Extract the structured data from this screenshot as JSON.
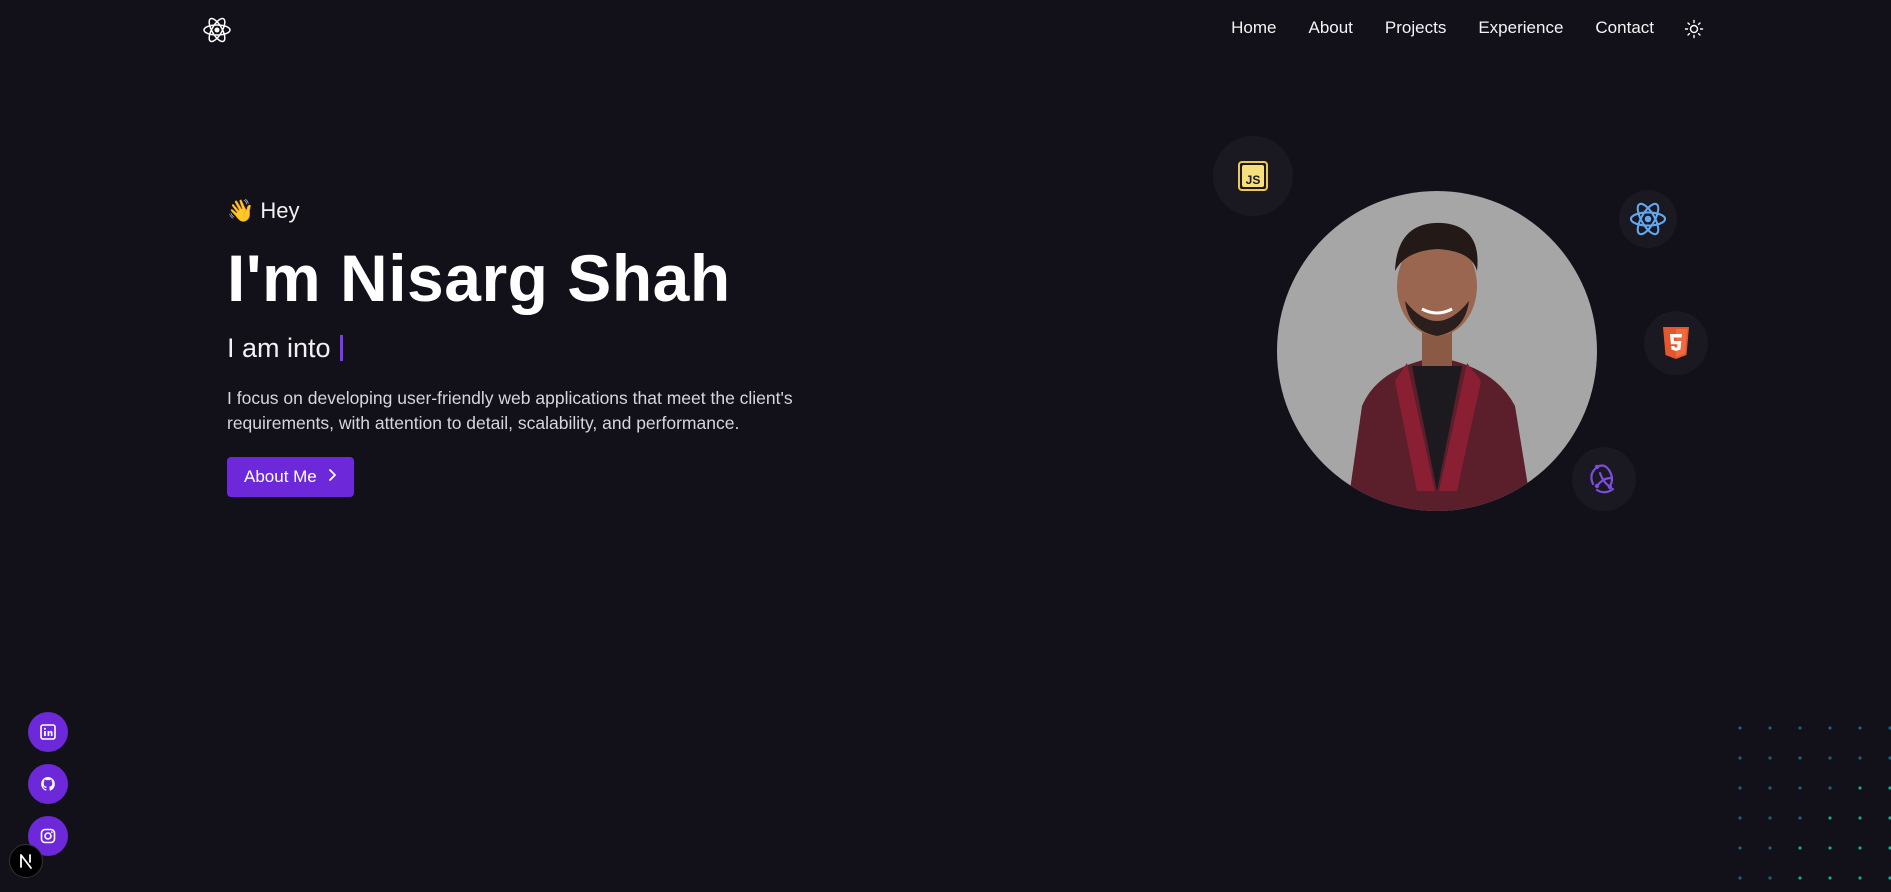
{
  "nav": {
    "links": [
      "Home",
      "About",
      "Projects",
      "Experience",
      "Contact"
    ],
    "logo_icon": "react-atom-icon",
    "theme_icon": "sun-icon"
  },
  "hero": {
    "greeting_emoji": "👋",
    "greeting": "Hey",
    "name": "I'm Nisarg Shah",
    "intro_prefix": "I am into",
    "description": "I focus on developing user-friendly web applications that meet the client's requirements, with attention to detail, scalability, and performance.",
    "cta_label": "About Me"
  },
  "tech_icons": [
    "javascript-icon",
    "react-icon",
    "html5-icon",
    "redux-icon"
  ],
  "socials": [
    "linkedin-icon",
    "github-icon",
    "instagram-icon"
  ],
  "colors": {
    "background": "#121018",
    "accent": "#6d28d9",
    "text": "#ffffff"
  }
}
